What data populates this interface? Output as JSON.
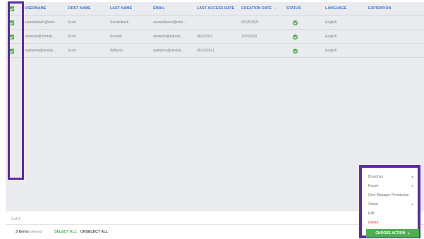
{
  "header": {
    "columns": [
      {
        "key": "username",
        "label": "USERNAME"
      },
      {
        "key": "first_name",
        "label": "FIRST NAME"
      },
      {
        "key": "last_name",
        "label": "LAST NAME"
      },
      {
        "key": "email",
        "label": "EMAIL"
      },
      {
        "key": "last_access_date",
        "label": "LAST ACCESS DATE"
      },
      {
        "key": "creation_date",
        "label": "CREATION DATE"
      },
      {
        "key": "status",
        "label": "STATUS"
      },
      {
        "key": "language",
        "label": "LANGUAGE"
      },
      {
        "key": "expiration",
        "label": "EXPIRATION"
      }
    ],
    "sort_indicator": "↓"
  },
  "rows": [
    {
      "username": "ssendelbach@mini...",
      "first_name": "Scott",
      "last_name": "Sendelbach",
      "email": "ssendelbach@mini...",
      "last_access_date": "",
      "creation_date": "05/25/2021",
      "status": "active",
      "language": "English",
      "expiration": ""
    },
    {
      "username": "skowicki@mintab...",
      "first_name": "Scott",
      "last_name": "Kowicki",
      "email": "skowicki@mintab...",
      "last_access_date": "06/2/2021",
      "creation_date": "10/5/2020",
      "status": "active",
      "language": "English",
      "expiration": ""
    },
    {
      "username": "swilliams@mintab...",
      "first_name": "Scott",
      "last_name": "Williams",
      "email": "swilliams@mintab...",
      "last_access_date": "05/25/2021",
      "creation_date": "",
      "status": "active",
      "language": "English",
      "expiration": ""
    }
  ],
  "pager": {
    "text": "3 of 3"
  },
  "footer": {
    "count": "3",
    "items_label": "Items",
    "selected_label": "selected",
    "select_all": "SELECT ALL",
    "unselect_all": "UNSELECT ALL"
  },
  "menu": {
    "items": [
      {
        "label": "Branches",
        "has_submenu": true
      },
      {
        "label": "Export",
        "has_submenu": true
      },
      {
        "label": "Give Manager Permission",
        "has_submenu": false
      },
      {
        "label": "Status",
        "has_submenu": true
      },
      {
        "label": "Edit",
        "has_submenu": false
      },
      {
        "label": "Delete",
        "has_submenu": false,
        "danger": true
      }
    ],
    "choose_action": "CHOOSE ACTION"
  },
  "colors": {
    "accent_green": "#4caf50",
    "header_blue": "#3d72c7",
    "highlight_purple": "#5e2ba2",
    "delete_red": "#e53935"
  }
}
